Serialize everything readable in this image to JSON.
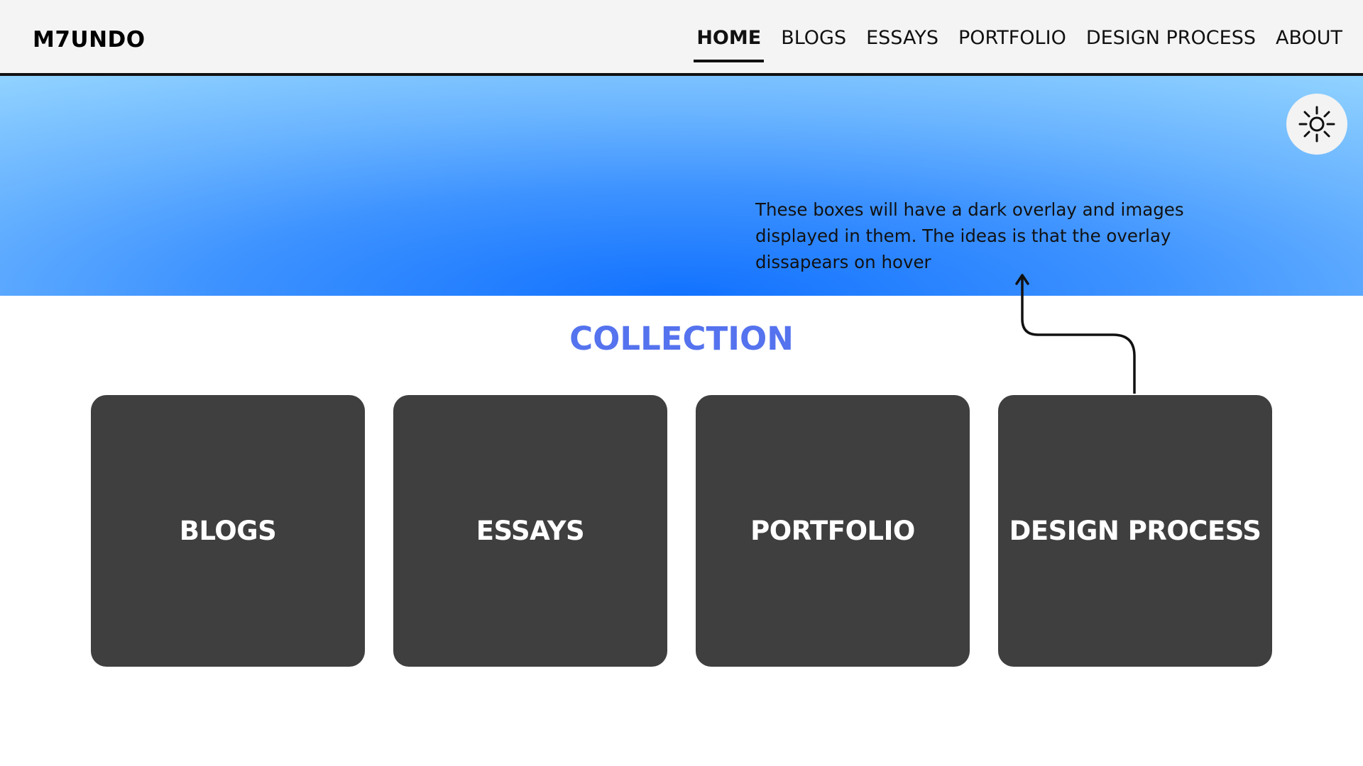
{
  "header": {
    "brand": "M7UNDO",
    "nav": [
      {
        "label": "HOME",
        "active": true
      },
      {
        "label": "BLOGS",
        "active": false
      },
      {
        "label": "ESSAYS",
        "active": false
      },
      {
        "label": "PORTFOLIO",
        "active": false
      },
      {
        "label": "DESIGN PROCESS",
        "active": false
      },
      {
        "label": "ABOUT",
        "active": false
      }
    ]
  },
  "hero": {
    "theme_toggle_icon": "sun-icon",
    "annotation": "These boxes will have a dark overlay and images displayed in them. The ideas is that the overlay dissapears on hover"
  },
  "collection": {
    "title": "COLLECTION",
    "cards": [
      {
        "label": "BLOGS"
      },
      {
        "label": "ESSAYS"
      },
      {
        "label": "PORTFOLIO"
      },
      {
        "label": "DESIGN PROCESS"
      }
    ]
  },
  "colors": {
    "nav_background": "#f4f4f4",
    "hero_center": "#1272ff",
    "hero_edge": "#8fd1ff",
    "section_title": "#5573ee",
    "card_background": "#3f3f3f",
    "card_text": "#ffffff"
  }
}
